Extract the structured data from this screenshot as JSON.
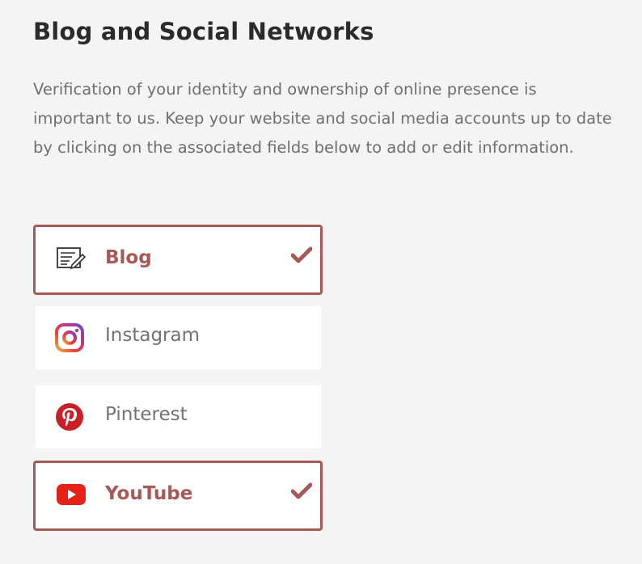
{
  "section": {
    "title": "Blog and Social Networks",
    "description": "Verification of your identity and ownership of online presence is important to us. Keep your website and social media accounts up to date by clicking on the associated fields below to add or edit information."
  },
  "networks": [
    {
      "label": "Blog",
      "icon": "blog-edit-icon",
      "connected": true
    },
    {
      "label": "Instagram",
      "icon": "instagram-icon",
      "connected": false
    },
    {
      "label": "Pinterest",
      "icon": "pinterest-icon",
      "connected": false
    },
    {
      "label": "YouTube",
      "icon": "youtube-icon",
      "connected": true
    }
  ],
  "colors": {
    "accent": "#a55a56",
    "background": "#f4f4f4",
    "heading": "#2b2b2b",
    "body_text": "#6f6f6f",
    "card": "#ffffff"
  }
}
